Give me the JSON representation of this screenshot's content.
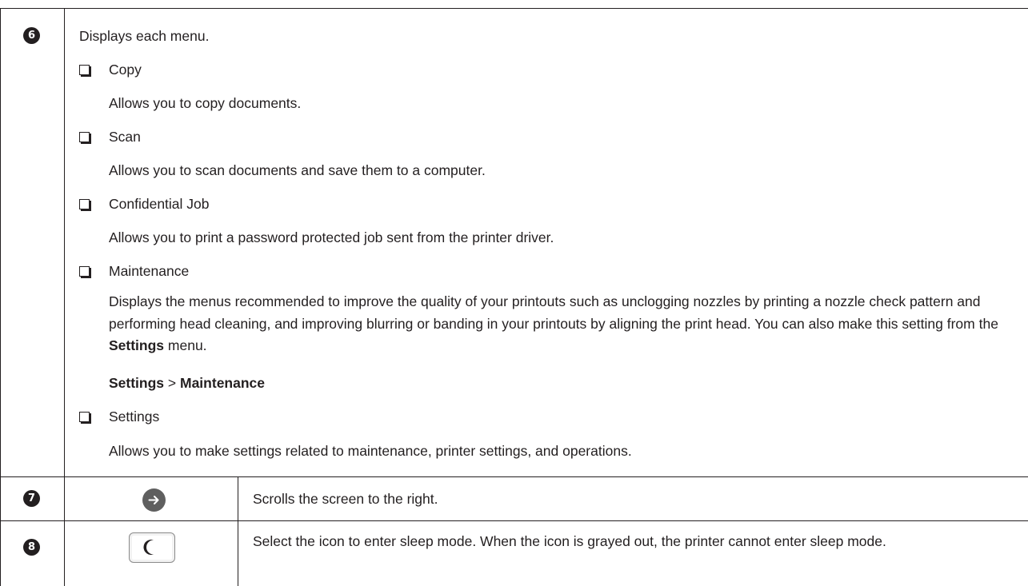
{
  "rows": {
    "row6": {
      "number": "6",
      "intro": "Displays each menu.",
      "items": [
        {
          "label": "Copy",
          "desc": "Allows you to copy documents."
        },
        {
          "label": "Scan",
          "desc": "Allows you to scan documents and save them to a computer."
        },
        {
          "label": "Confidential Job",
          "desc": "Allows you to print a password protected job sent from the printer driver."
        },
        {
          "label": "Maintenance",
          "desc_part1": "Displays the menus recommended to improve the quality of your printouts such as unclogging nozzles by printing a nozzle check pattern and performing head cleaning, and improving blurring or banding in your printouts by aligning the print head. You can also make this setting from the ",
          "desc_bold": "Settings",
          "desc_part2": " menu.",
          "path_a": "Settings",
          "path_sep": " > ",
          "path_b": "Maintenance"
        },
        {
          "label": "Settings",
          "desc": "Allows you to make settings related to maintenance, printer settings, and operations."
        }
      ]
    },
    "row7": {
      "number": "7",
      "icon": "arrow-right-circle-icon",
      "desc": "Scrolls the screen to the right."
    },
    "row8": {
      "number": "8",
      "icon": "moon-sleep-icon",
      "desc": "Select the icon to enter sleep mode. When the icon is grayed out, the printer cannot enter sleep mode."
    }
  },
  "colors": {
    "text": "#231f20",
    "icon_fill": "#5f5f5f",
    "border": "#231f20"
  }
}
